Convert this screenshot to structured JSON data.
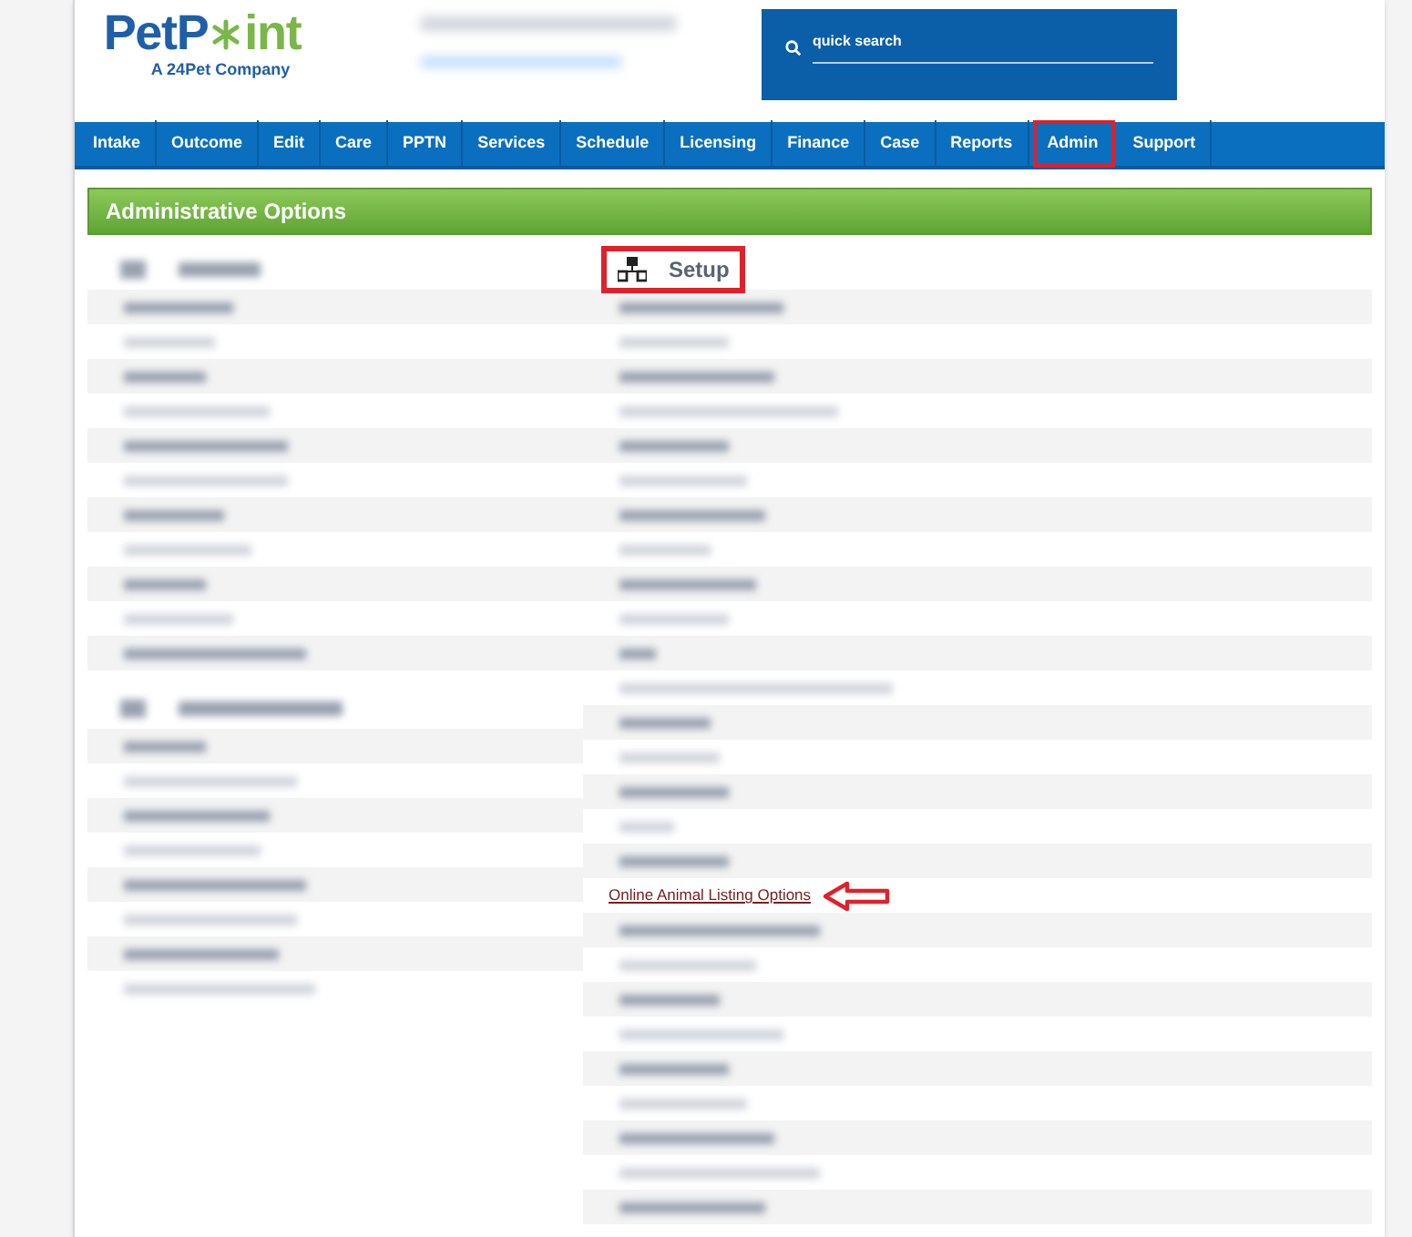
{
  "logo": {
    "name_start": "PetP",
    "name_end": "int",
    "tagline": "A 24Pet Company"
  },
  "search": {
    "placeholder": "quick search"
  },
  "nav": [
    {
      "label": "Intake",
      "highlighted": false
    },
    {
      "label": "Outcome",
      "highlighted": false
    },
    {
      "label": "Edit",
      "highlighted": false
    },
    {
      "label": "Care",
      "highlighted": false
    },
    {
      "label": "PPTN",
      "highlighted": false
    },
    {
      "label": "Services",
      "highlighted": false
    },
    {
      "label": "Schedule",
      "highlighted": false
    },
    {
      "label": "Licensing",
      "highlighted": false
    },
    {
      "label": "Finance",
      "highlighted": false
    },
    {
      "label": "Case",
      "highlighted": false
    },
    {
      "label": "Reports",
      "highlighted": false
    },
    {
      "label": "Admin",
      "highlighted": true
    },
    {
      "label": "Support",
      "highlighted": false
    }
  ],
  "page_title": "Administrative Options",
  "setup": {
    "title": "Setup",
    "highlighted": true
  },
  "link": {
    "label": "Online Animal Listing Options",
    "pointed_at": true
  }
}
